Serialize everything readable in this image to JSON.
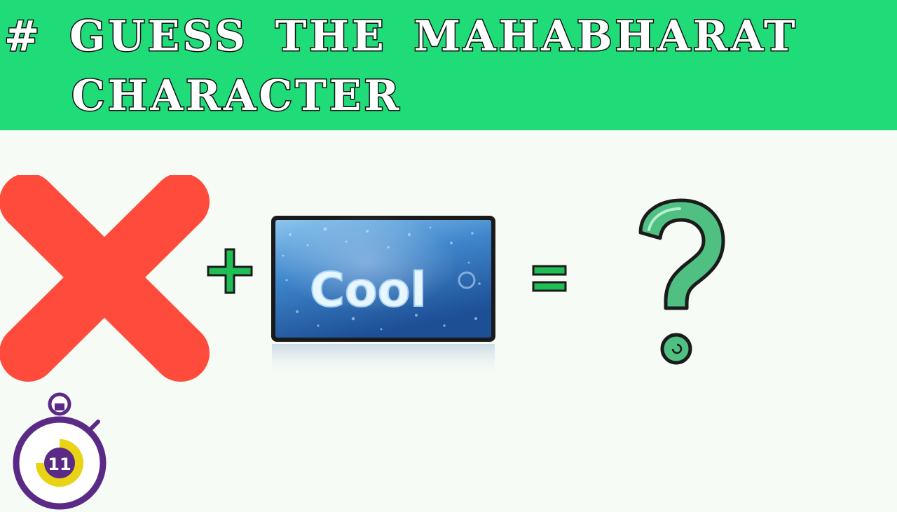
{
  "header": {
    "title_line1": "# GUESS THE MAHABHARAT",
    "title_line2": "CHARACTER",
    "background_color": "#1fdc78"
  },
  "puzzle": {
    "clue1_icon": "red-cross-icon",
    "operator_plus": "+",
    "clue2_text": "Cool",
    "operator_equals": "=",
    "answer_icon": "question-mark-icon",
    "colors": {
      "cross": "#ff4b3c",
      "operator": "#1fbf55",
      "question_mark": "#4fc082",
      "cool_card_blue": "#2d6fb8"
    }
  },
  "timer": {
    "value": "11",
    "ring_color": "#5a2a86",
    "fill_color": "#e8d414"
  }
}
